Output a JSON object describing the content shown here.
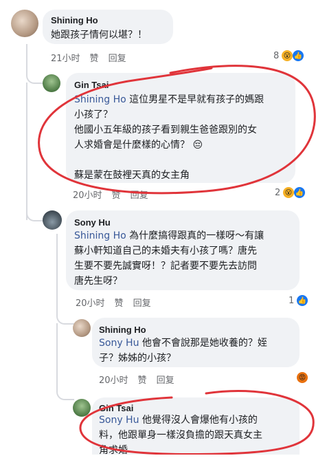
{
  "comments": [
    {
      "author": "Shining Ho",
      "text": "她跟孩子情何以堪？！",
      "meta": {
        "time": "21小时",
        "like": "赞",
        "reply": "回复"
      },
      "reaction_count": "8"
    },
    {
      "author": "Gin Tsai",
      "mention": "Shining Ho",
      "text": " 這位男星不是早就有孩子的媽跟\n小孩了？\n他國小五年級的孩子看到親生爸爸跟別的女\n人求婚會是什麼樣的心情？ 😔\n\n蘇是蒙在鼓裡天真的女主角",
      "meta": {
        "time": "20小时",
        "like": "赞",
        "reply": "回复"
      },
      "reaction_count": "2"
    },
    {
      "author": "Sony Hu",
      "mention": "Shining Ho",
      "text": " 為什麼搞得跟真的一樣呀～有讓\n蘇小軒知道自己的未婚夫有小孩了嗎？唐先\n生要不要先誠實呀！？記者要不要先去訪問\n唐先生呀？",
      "meta": {
        "time": "20小时",
        "like": "赞",
        "reply": "回复"
      },
      "reaction_count": "1"
    },
    {
      "author": "Shining Ho",
      "mention": "Sony Hu",
      "text": " 他會不會說那是她收養的？姪\n子？姊姊的小孩？",
      "meta": {
        "time": "20小时",
        "like": "赞",
        "reply": "回复"
      }
    },
    {
      "author": "Gin Tsai",
      "mention": "Sony Hu",
      "text": " 他覺得沒人會爆他有小孩的\n料，他跟單身一樣沒負擔的跟天真女主\n角求婚"
    }
  ],
  "colors": {
    "annotation": "#e0343a",
    "mention": "#385898",
    "bubble": "#f0f2f5"
  }
}
